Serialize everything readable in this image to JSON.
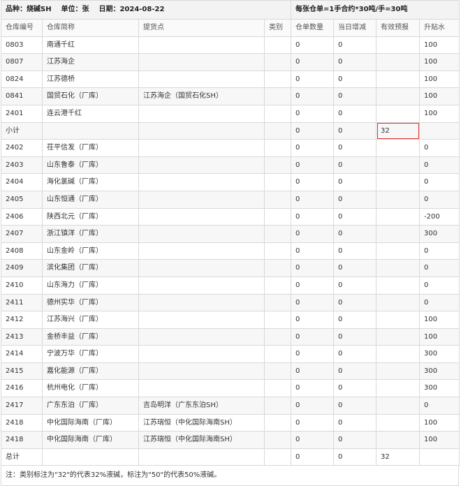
{
  "header": {
    "product_label": "品种：",
    "product": "烧碱SH",
    "unit_label": "单位：",
    "unit": "张",
    "date_label": "日期：",
    "date": "2024-08-22",
    "contract_note": "每张仓单=1手合约*30吨/手=30吨"
  },
  "columns": [
    "仓库编号",
    "仓库简称",
    "提货点",
    "类别",
    "仓单数量",
    "当日增减",
    "有效预报",
    "升贴水"
  ],
  "rows": [
    {
      "id": "0803",
      "name": "南通千红",
      "pickup": "",
      "cat": "",
      "qty": "0",
      "chg": "0",
      "forecast": "",
      "prem": "100"
    },
    {
      "id": "0807",
      "name": "江苏海企",
      "pickup": "",
      "cat": "",
      "qty": "0",
      "chg": "0",
      "forecast": "",
      "prem": "100"
    },
    {
      "id": "0824",
      "name": "江苏德桥",
      "pickup": "",
      "cat": "",
      "qty": "0",
      "chg": "0",
      "forecast": "",
      "prem": "100"
    },
    {
      "id": "0841",
      "name": "国贸石化（厂库）",
      "pickup": "江苏海企（国贸石化SH）",
      "cat": "",
      "qty": "0",
      "chg": "0",
      "forecast": "",
      "prem": "100"
    },
    {
      "id": "2401",
      "name": "连云港千红",
      "pickup": "",
      "cat": "",
      "qty": "0",
      "chg": "0",
      "forecast": "",
      "prem": "100"
    },
    {
      "id": "小计",
      "name": "",
      "pickup": "",
      "cat": "",
      "qty": "0",
      "chg": "0",
      "forecast": "32",
      "prem": ""
    },
    {
      "id": "2402",
      "name": "茌平信发（厂库）",
      "pickup": "",
      "cat": "",
      "qty": "0",
      "chg": "0",
      "forecast": "",
      "prem": "0"
    },
    {
      "id": "2403",
      "name": "山东鲁泰（厂库）",
      "pickup": "",
      "cat": "",
      "qty": "0",
      "chg": "0",
      "forecast": "",
      "prem": "0"
    },
    {
      "id": "2404",
      "name": "海化氯碱（厂库）",
      "pickup": "",
      "cat": "",
      "qty": "0",
      "chg": "0",
      "forecast": "",
      "prem": "0"
    },
    {
      "id": "2405",
      "name": "山东恒通（厂库）",
      "pickup": "",
      "cat": "",
      "qty": "0",
      "chg": "0",
      "forecast": "",
      "prem": "0"
    },
    {
      "id": "2406",
      "name": "陕西北元（厂库）",
      "pickup": "",
      "cat": "",
      "qty": "0",
      "chg": "0",
      "forecast": "",
      "prem": "-200"
    },
    {
      "id": "2407",
      "name": "浙江镇洋（厂库）",
      "pickup": "",
      "cat": "",
      "qty": "0",
      "chg": "0",
      "forecast": "",
      "prem": "300"
    },
    {
      "id": "2408",
      "name": "山东金岭（厂库）",
      "pickup": "",
      "cat": "",
      "qty": "0",
      "chg": "0",
      "forecast": "",
      "prem": "0"
    },
    {
      "id": "2409",
      "name": "滨化集团（厂库）",
      "pickup": "",
      "cat": "",
      "qty": "0",
      "chg": "0",
      "forecast": "",
      "prem": "0"
    },
    {
      "id": "2410",
      "name": "山东海力（厂库）",
      "pickup": "",
      "cat": "",
      "qty": "0",
      "chg": "0",
      "forecast": "",
      "prem": "0"
    },
    {
      "id": "2411",
      "name": "德州实华（厂库）",
      "pickup": "",
      "cat": "",
      "qty": "0",
      "chg": "0",
      "forecast": "",
      "prem": "0"
    },
    {
      "id": "2412",
      "name": "江苏海兴（厂库）",
      "pickup": "",
      "cat": "",
      "qty": "0",
      "chg": "0",
      "forecast": "",
      "prem": "100"
    },
    {
      "id": "2413",
      "name": "金桥丰益（厂库）",
      "pickup": "",
      "cat": "",
      "qty": "0",
      "chg": "0",
      "forecast": "",
      "prem": "100"
    },
    {
      "id": "2414",
      "name": "宁波万华（厂库）",
      "pickup": "",
      "cat": "",
      "qty": "0",
      "chg": "0",
      "forecast": "",
      "prem": "300"
    },
    {
      "id": "2415",
      "name": "嘉化能源（厂库）",
      "pickup": "",
      "cat": "",
      "qty": "0",
      "chg": "0",
      "forecast": "",
      "prem": "300"
    },
    {
      "id": "2416",
      "name": "杭州电化（厂库）",
      "pickup": "",
      "cat": "",
      "qty": "0",
      "chg": "0",
      "forecast": "",
      "prem": "300"
    },
    {
      "id": "2417",
      "name": "广东东泊（厂库）",
      "pickup": "吉岛明洋（广东东泊SH）",
      "cat": "",
      "qty": "0",
      "chg": "0",
      "forecast": "",
      "prem": "0"
    },
    {
      "id": "2418",
      "name": "中化国际海南（厂库）",
      "pickup": "江苏瑞恒（中化国际海南SH）",
      "cat": "",
      "qty": "0",
      "chg": "0",
      "forecast": "",
      "prem": "100"
    },
    {
      "id": "2418",
      "name": "中化国际海南（厂库）",
      "pickup": "江苏瑞恒（中化国际海南SH）",
      "cat": "",
      "qty": "0",
      "chg": "0",
      "forecast": "",
      "prem": "100"
    },
    {
      "id": "总计",
      "name": "",
      "pickup": "",
      "cat": "",
      "qty": "0",
      "chg": "0",
      "forecast": "32",
      "prem": ""
    }
  ],
  "footnote": "注：类别标注为\"32\"的代表32%液碱，标注为\"50\"的代表50%液碱。",
  "colors": {
    "header_bg": "#f3f3f3",
    "alt_row": "#f7f7f7",
    "border": "#d9d9d9",
    "highlight": "#e0302a"
  }
}
